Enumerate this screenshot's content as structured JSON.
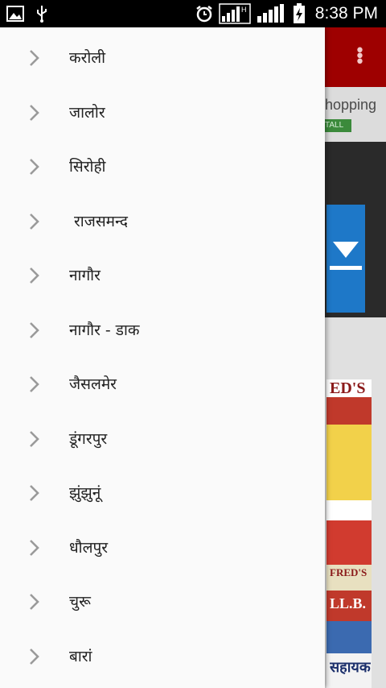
{
  "status_bar": {
    "time": "8:38 PM",
    "icons": [
      "gallery-icon",
      "usb-icon",
      "alarm-icon",
      "signal-h-icon",
      "signal-icon",
      "battery-charging-icon"
    ]
  },
  "background_app": {
    "ad_text": "hopping",
    "install_label": "TALL",
    "news_header": "ED'S",
    "news_header2": "FRED'S",
    "news_llb": "LL.B.",
    "news_bottom": "सहायक"
  },
  "drawer": {
    "items": [
      {
        "label": "करोली"
      },
      {
        "label": "जालोर"
      },
      {
        "label": "सिरोही"
      },
      {
        "label": " राजसमन्द"
      },
      {
        "label": "नागौर"
      },
      {
        "label": "नागौर - डाक"
      },
      {
        "label": "जैसलमेर"
      },
      {
        "label": "डूंगरपुर"
      },
      {
        "label": "झुंझुनूं"
      },
      {
        "label": "धौलपुर"
      },
      {
        "label": "चुरू"
      },
      {
        "label": "बारां"
      }
    ]
  },
  "colors": {
    "toolbar": "#9e0000",
    "drawer_bg": "#fafafa",
    "chevron": "#9a9a9a",
    "download_blue": "#1e78c8"
  }
}
